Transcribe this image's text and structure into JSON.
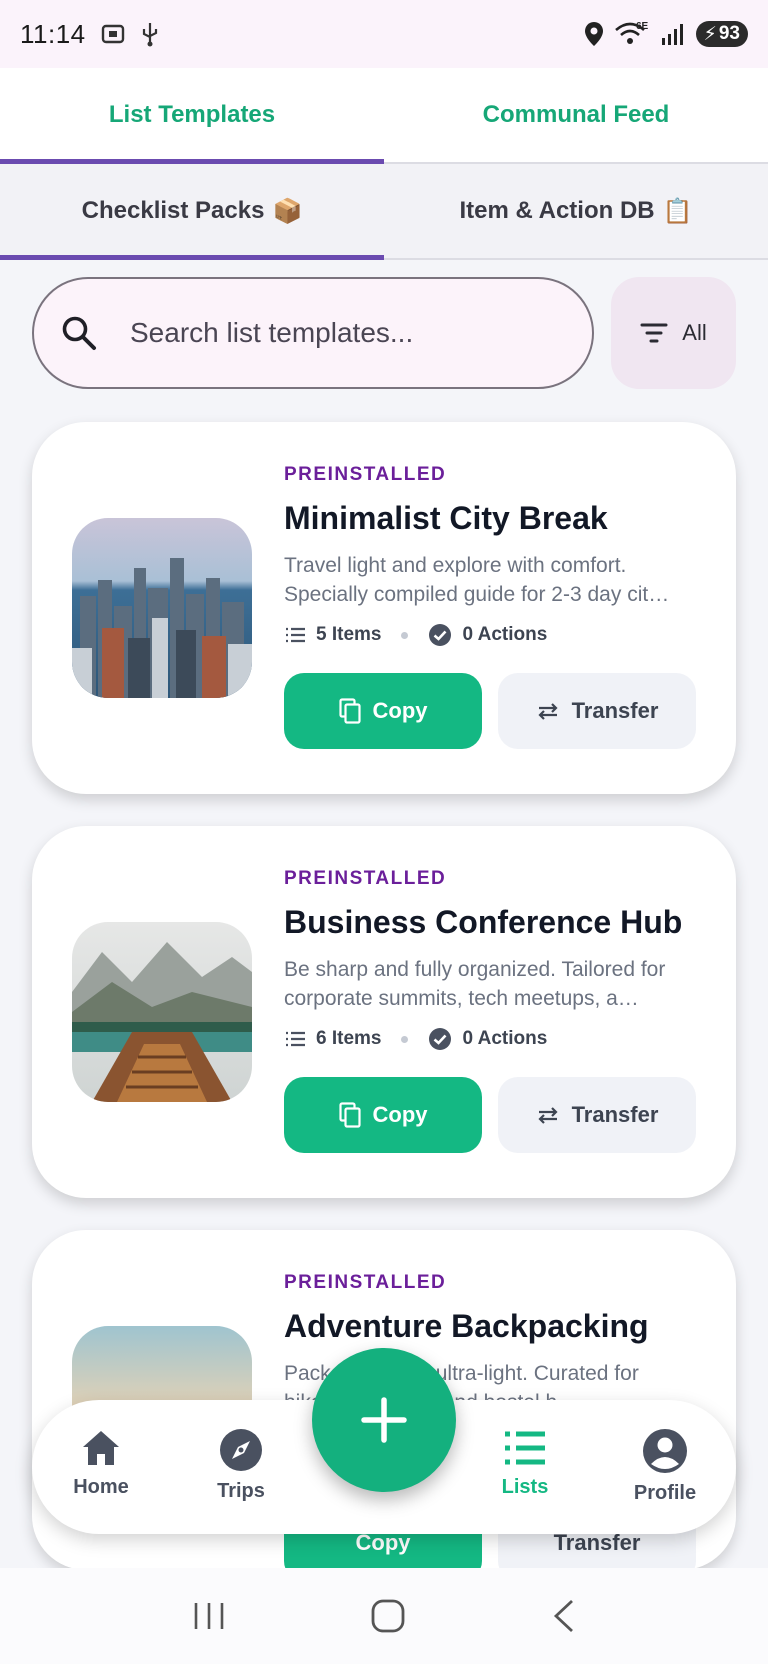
{
  "status_bar": {
    "time": "11:14",
    "battery": "93",
    "network": "6E"
  },
  "tabs_primary": [
    {
      "label": "List Templates",
      "active": true
    },
    {
      "label": "Communal Feed",
      "active": false
    }
  ],
  "tabs_secondary": [
    {
      "label": "Checklist Packs",
      "emoji": "📦",
      "active": true
    },
    {
      "label": "Item & Action DB",
      "emoji": "📋",
      "active": false
    }
  ],
  "search": {
    "placeholder": "Search list templates...",
    "value": ""
  },
  "filter": {
    "label": "All"
  },
  "cards": [
    {
      "badge": "PREINSTALLED",
      "title": "Minimalist City Break",
      "description": "Travel light and explore with comfort. Specially compiled guide for 2-3 day cit…",
      "items": "5 Items",
      "actions": "0 Actions",
      "copy_label": "Copy",
      "transfer_label": "Transfer"
    },
    {
      "badge": "PREINSTALLED",
      "title": "Business Conference Hub",
      "description": "Be sharp and fully organized. Tailored for corporate summits, tech meetups, a…",
      "items": "6 Items",
      "actions": "0 Actions",
      "copy_label": "Copy",
      "transfer_label": "Transfer"
    },
    {
      "badge": "PREINSTALLED",
      "title": "Adventure Backpacking",
      "description": "Pack smart and ultra-light. Curated for hikers, sleepers, and hostel h…",
      "items": "",
      "actions": "",
      "copy_label": "Copy",
      "transfer_label": "Transfer"
    }
  ],
  "bottom_nav": [
    {
      "label": "Home",
      "icon": "home-icon",
      "active": false
    },
    {
      "label": "Trips",
      "icon": "compass-icon",
      "active": false
    },
    {
      "label": "Lists",
      "icon": "list-icon",
      "active": true
    },
    {
      "label": "Profile",
      "icon": "account-icon",
      "active": false
    }
  ],
  "colors": {
    "accent": "#14b883",
    "indicator": "#6b4bb0",
    "badge": "#6b1f9a"
  }
}
